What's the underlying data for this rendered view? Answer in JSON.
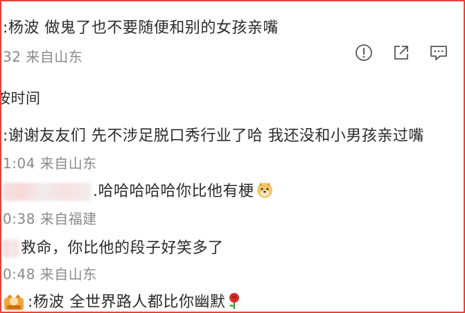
{
  "comments": [
    {
      "text": ":杨波  做鬼了也不要随便和别的女孩亲嘴",
      "meta": "32 来自山东"
    },
    {
      "header": "按时间"
    },
    {
      "text": ":谢谢友友们 先不涉足脱口秀行业了哈 我还没和小男孩亲过嘴",
      "meta": "1:04 来自山东"
    },
    {
      "text": ".哈哈哈哈哈你比他有梗",
      "meta": "0:38 来自福建"
    },
    {
      "text": "救命，你比他的段子好笑多了",
      "meta": "0:48 来自山东"
    },
    {
      "text": ":杨波  全世界路人都比你幽默"
    }
  ],
  "actions": {
    "report_icon": "exclamation-circle",
    "share_icon": "share-arrow",
    "comment_icon": "comment-bubble"
  },
  "colors": {
    "border": "#e8413b",
    "text": "#2b2b2b",
    "meta": "#8a8a8a"
  }
}
